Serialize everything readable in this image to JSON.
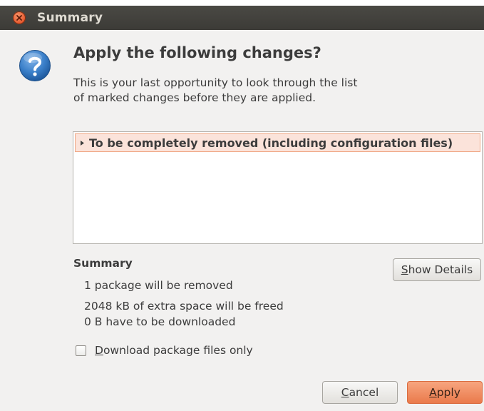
{
  "window": {
    "title": "Summary"
  },
  "dialog": {
    "heading": "Apply the following changes?",
    "description": "This is your last opportunity to look through the list of marked changes before they are applied.",
    "change_list": {
      "rows": [
        {
          "label": "To be completely removed (including configuration files)",
          "expanded": false
        }
      ]
    },
    "summary": {
      "heading": "Summary",
      "lines": [
        "1 package will be removed",
        "2048 kB of extra space will be freed",
        "0  B have to be downloaded"
      ]
    },
    "show_details_button": {
      "mnemonic": "S",
      "rest": "how Details"
    },
    "download_only_checkbox": {
      "checked": false,
      "mnemonic": "D",
      "rest": "ownload package files only"
    },
    "cancel_button": {
      "mnemonic": "C",
      "rest": "ancel"
    },
    "apply_button": {
      "mnemonic": "A",
      "rest": "pply"
    }
  },
  "colors": {
    "titlebar": "#3c3b37",
    "dialog_background": "#f2f1f0",
    "accent": "#ea7a4b",
    "selection_fill": "#fbe3da",
    "question_icon": "#2a6fb8"
  },
  "icons": {
    "close": "close-icon",
    "question": "question-icon",
    "expander": "expander-arrow-icon"
  }
}
